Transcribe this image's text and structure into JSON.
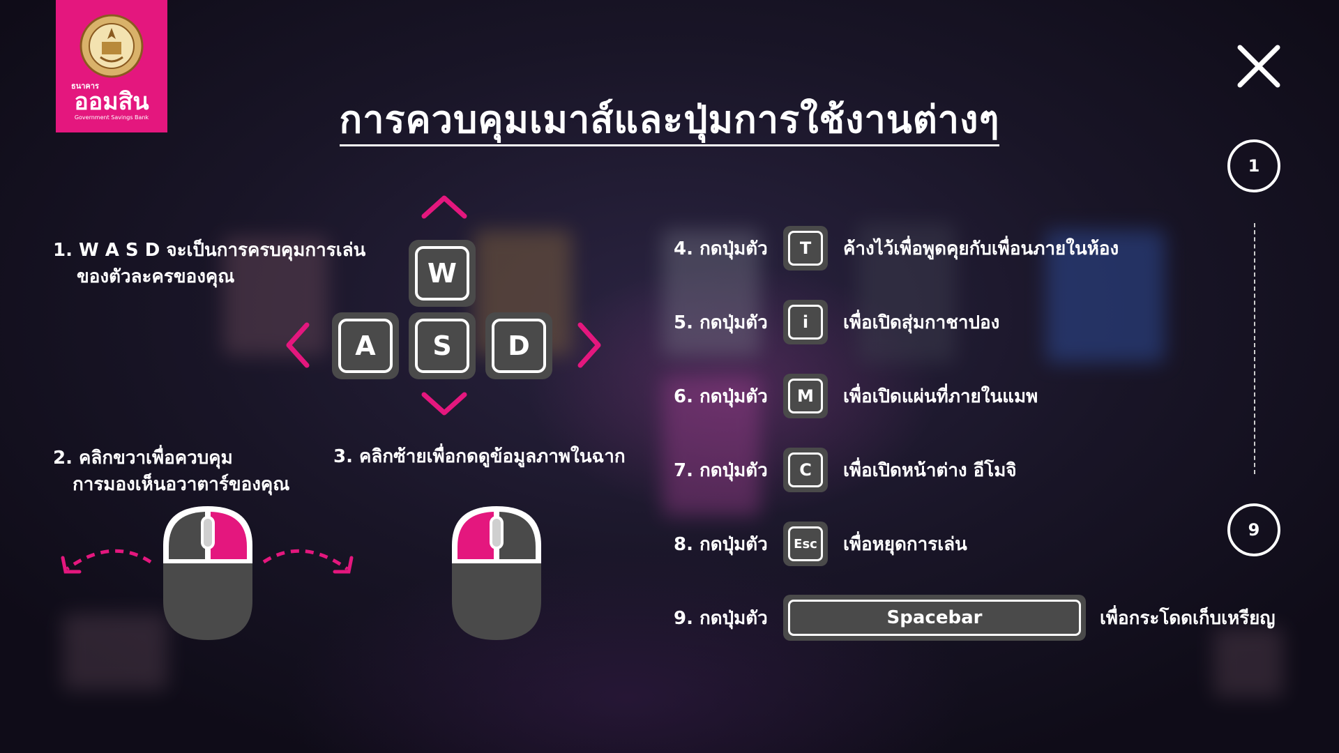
{
  "colors": {
    "accent": "#e4177e",
    "key_bg": "#4a4a4a",
    "close": "#ffffff"
  },
  "logo": {
    "seal_text": "ธนาคารออมสิน รัฐบาลเป็นประกัน",
    "small": "ธนาคาร",
    "name": "ออมสิน",
    "english": "Government Savings Bank"
  },
  "title": "การควบคุมเมาส์และปุ่มการใช้งานต่างๆ",
  "close_icon": "close-icon",
  "pager": {
    "current": "1",
    "last": "9"
  },
  "left": {
    "instr1": [
      "1.  W A S D จะเป็นการครบคุมการเล่น",
      "     ของตัวละครของคุณ"
    ],
    "keys": {
      "w": "W",
      "a": "A",
      "s": "S",
      "d": "D"
    },
    "instr2": [
      "2. คลิกขวาเพื่อควบคุม",
      "    การมองเห็นอวาตาร์ของคุณ"
    ],
    "instr3": "3. คลิกซ้ายเพื่อกดดูข้อมูลภาพในฉาก"
  },
  "right": {
    "rows": [
      {
        "label": "4. กดปุ่มตัว",
        "key": "T",
        "desc": "ค้างไว้เพื่อพูดคุยกับเพื่อนภายในห้อง"
      },
      {
        "label": "5. กดปุ่มตัว",
        "key": "i",
        "desc": "เพื่อเปิดสุ่มกาชาปอง"
      },
      {
        "label": "6. กดปุ่มตัว",
        "key": "M",
        "desc": "เพื่อเปิดแผ่นที่ภายในแมพ"
      },
      {
        "label": "7. กดปุ่มตัว",
        "key": "C",
        "desc": "เพื่อเปิดหน้าต่าง อีโมจิ"
      },
      {
        "label": "8. กดปุ่มตัว",
        "key": "Esc",
        "desc": "เพื่อหยุดการเล่น"
      },
      {
        "label": "9. กดปุ่มตัว",
        "key": "Spacebar",
        "desc": "เพื่อกระโดดเก็บเหรียญ"
      }
    ]
  }
}
